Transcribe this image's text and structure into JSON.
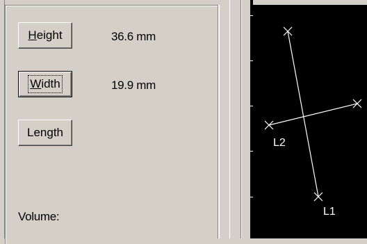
{
  "buttons": {
    "height": {
      "accel": "H",
      "rest": "eight"
    },
    "width": {
      "accel": "W",
      "rest": "idth"
    },
    "length": {
      "label": "Length"
    }
  },
  "values": {
    "height": "36.6 mm",
    "width": "19.9 mm"
  },
  "volume_label": "Volume:",
  "viewer": {
    "labels": {
      "l1": "L1",
      "l2": "L2"
    },
    "colors": {
      "background": "#000000",
      "line": "#ffffff"
    }
  }
}
